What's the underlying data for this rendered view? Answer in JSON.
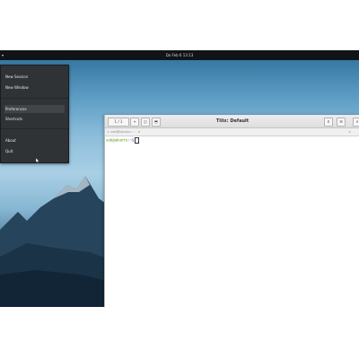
{
  "topbar": {
    "app_menu": "▾",
    "clock": "Do Feb 6 13:13"
  },
  "app_menu": {
    "items": [
      "New Session",
      "New Window",
      "Preferences",
      "Shortcuts",
      "About",
      "Quit"
    ],
    "highlighted": "Preferences"
  },
  "terminal": {
    "title": "Tilix: Default",
    "session_button": "1 / 1",
    "add_button": "+",
    "split_h_button": "◫",
    "split_v_button": "⬒",
    "search_button": "⚲",
    "menu_button": "☰",
    "close_button": "×",
    "tab_label": "1: seb@ubuntu: ~",
    "tab_arrow": "▾",
    "prompt_user": "seb@ubuntu",
    "prompt_path": ":~$"
  },
  "colors": {
    "panel": "#111417",
    "menu_bg": "#2f3336",
    "prompt_user": "#4e9a06",
    "prompt_path": "#3465a4"
  }
}
